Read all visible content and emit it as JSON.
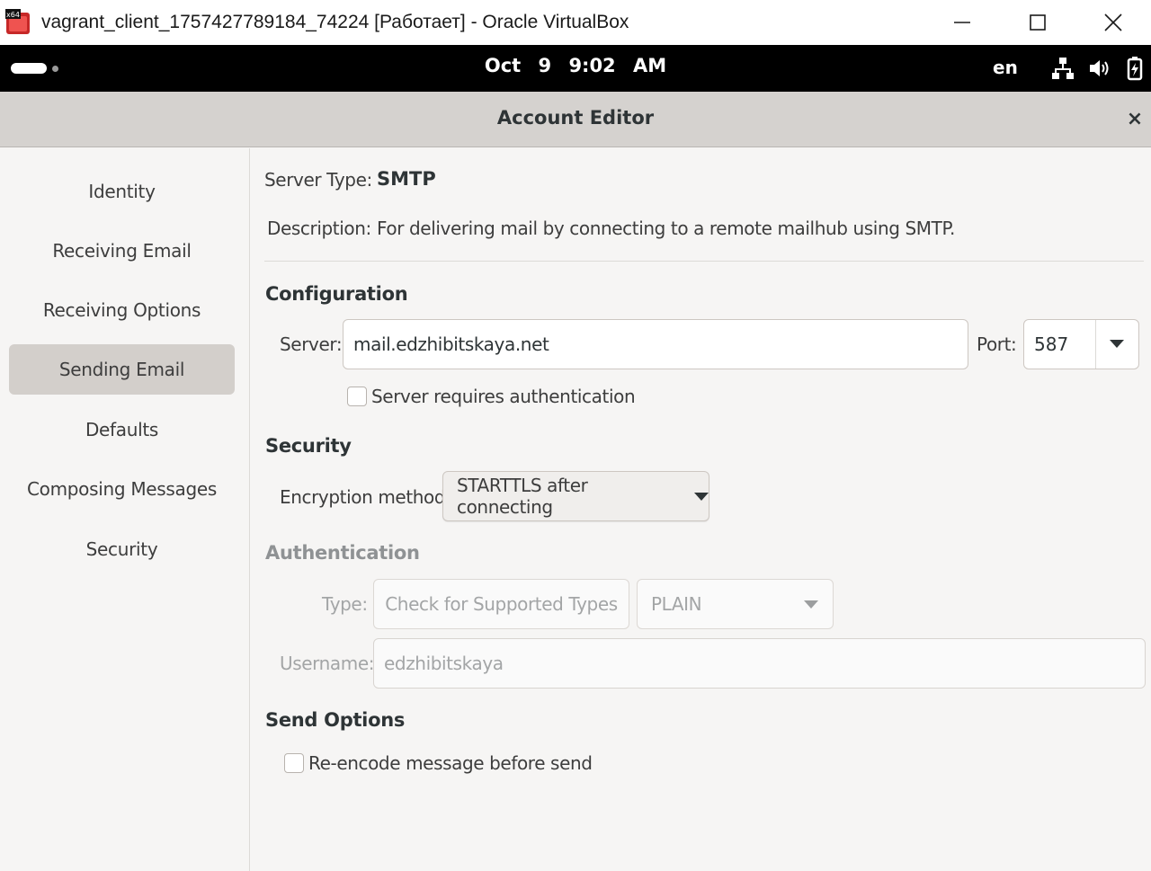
{
  "host_window": {
    "title": "vagrant_client_1757427789184_74224 [Работает] - Oracle VirtualBox",
    "app_icon_badge": "x64",
    "minimize_icon": "minimize-icon",
    "maximize_icon": "maximize-icon",
    "close_icon": "close-icon"
  },
  "topbar": {
    "date": "Oct 9",
    "time": "9:02 AM",
    "language": "en",
    "tray_icons": [
      "network-icon",
      "volume-icon",
      "battery-icon"
    ]
  },
  "dialog": {
    "title": "Account Editor",
    "close_label": "×"
  },
  "sidebar": {
    "items": [
      {
        "label": "Identity"
      },
      {
        "label": "Receiving Email"
      },
      {
        "label": "Receiving Options"
      },
      {
        "label": "Sending Email",
        "selected": true
      },
      {
        "label": "Defaults"
      },
      {
        "label": "Composing Messages"
      },
      {
        "label": "Security"
      }
    ]
  },
  "main": {
    "server_type_label": "Server Type:",
    "server_type_value": "SMTP",
    "description_label": "Description:",
    "description_value": "For delivering mail by connecting to a remote mailhub using SMTP.",
    "configuration": {
      "heading": "Configuration",
      "server_label": "Server:",
      "server_value": "mail.edzhibitskaya.net",
      "port_label": "Port:",
      "port_value": "587",
      "requires_auth_label": "Server requires authentication",
      "requires_auth_checked": false
    },
    "security": {
      "heading": "Security",
      "encryption_label": "Encryption method:",
      "encryption_value": "STARTTLS after connecting"
    },
    "authentication": {
      "heading": "Authentication",
      "type_label": "Type:",
      "check_button_label": "Check for Supported Types",
      "auth_type_value": "PLAIN",
      "username_label": "Username:",
      "username_value": "edzhibitskaya"
    },
    "send_options": {
      "heading": "Send Options",
      "reencode_label": "Re-encode message before send",
      "reencode_checked": false
    }
  },
  "colors": {
    "header_bg": "#d5d2cf",
    "selected_item_bg": "#d3cfcb",
    "topbar_bg": "#000000",
    "window_bg": "#f6f5f4"
  }
}
